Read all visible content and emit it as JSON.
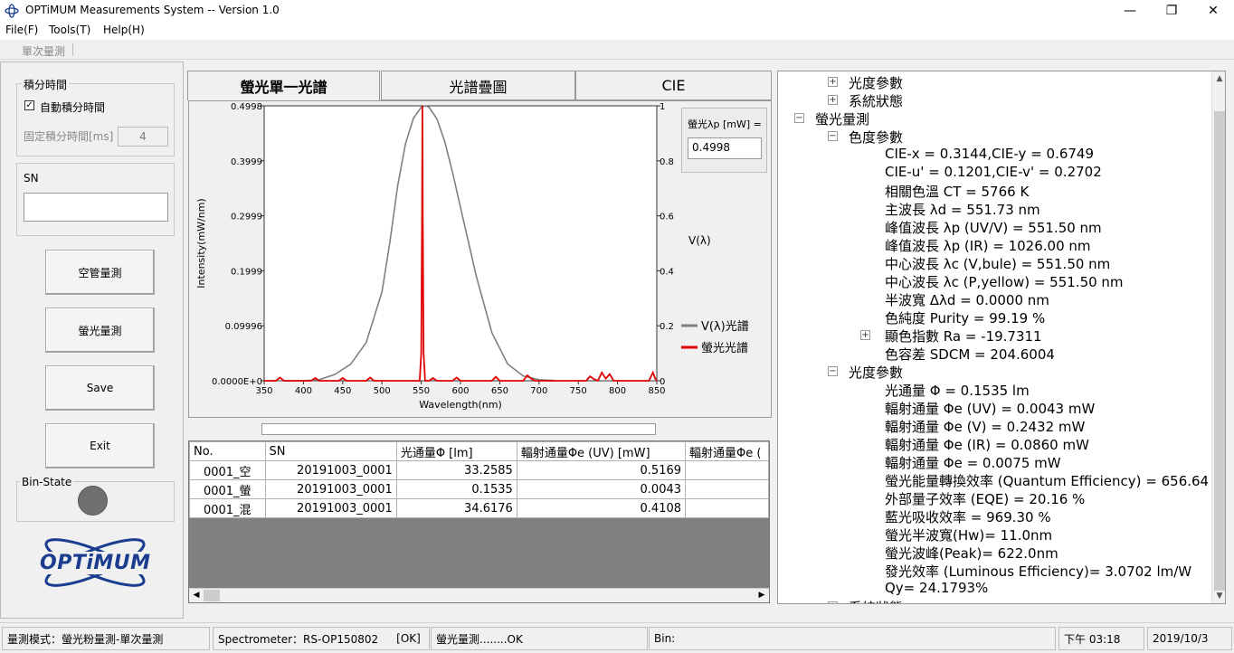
{
  "window": {
    "title": "OPTiMUM Measurements System -- Version 1.0"
  },
  "menu": {
    "file": "File(F)",
    "tools": "Tools(T)",
    "help": "Help(H)"
  },
  "toolbar": {
    "single_measure": "單次量測"
  },
  "left": {
    "integration_group": "積分時間",
    "auto_integration": "自動積分時間",
    "auto_checked": true,
    "fixed_integration_label": "固定積分時間[ms]",
    "fixed_integration_value": "4",
    "sn_label": "SN",
    "sn_value": "",
    "empty_tube_button": "空管量測",
    "fluorescence_button": "螢光量測",
    "save_button": "Save",
    "exit_button": "Exit",
    "bin_state_label": "Bin-State",
    "logo_text": "OPTiMUM"
  },
  "tabs": [
    "螢光單一光譜",
    "光譜疊圖",
    "CIE"
  ],
  "peak_box": {
    "label": "螢光λp [mW] =",
    "value": "0.4998"
  },
  "chart_data": {
    "type": "line",
    "xlabel": "Wavelength(nm)",
    "ylabel": "Intensity(mW/nm)",
    "y2label": "V(λ)",
    "xlim": [
      350,
      850
    ],
    "ylim": [
      0,
      0.4998
    ],
    "y2lim": [
      0,
      1
    ],
    "x_ticks": [
      "350",
      "400",
      "450",
      "500",
      "550",
      "600",
      "650",
      "700",
      "750",
      "800",
      "850"
    ],
    "y_ticks": [
      "0.0000E+0",
      "0.09996",
      "0.1999",
      "0.2999",
      "0.3999",
      "0.4998"
    ],
    "y2_ticks": [
      "0",
      "0.2",
      "0.4",
      "0.6",
      "0.8",
      "1"
    ],
    "legend_position": "right",
    "series": [
      {
        "name": "V(λ)光譜",
        "color": "#808080",
        "axis": "right",
        "x": [
          360,
          380,
          400,
          420,
          440,
          460,
          480,
          500,
          510,
          520,
          530,
          540,
          550,
          555,
          560,
          570,
          580,
          590,
          600,
          620,
          640,
          660,
          680,
          700,
          720
        ],
        "y": [
          0,
          0.0001,
          0.0004,
          0.004,
          0.023,
          0.06,
          0.139,
          0.323,
          0.503,
          0.71,
          0.862,
          0.954,
          0.995,
          1.0,
          0.995,
          0.952,
          0.87,
          0.757,
          0.631,
          0.381,
          0.175,
          0.061,
          0.017,
          0.004,
          0.001
        ]
      },
      {
        "name": "螢光光譜",
        "color": "#e00000",
        "axis": "left",
        "x": [
          350,
          365,
          370,
          375,
          400,
          410,
          415,
          420,
          445,
          450,
          455,
          480,
          485,
          490,
          540,
          548,
          550,
          551,
          551.5,
          552,
          553,
          555,
          560,
          565,
          570,
          590,
          595,
          600,
          640,
          645,
          650,
          680,
          685,
          690,
          695,
          760,
          765,
          770,
          775,
          780,
          785,
          790,
          795,
          840,
          845,
          848,
          850
        ],
        "y": [
          0,
          0,
          0.006,
          0,
          0,
          0,
          0.005,
          0,
          0,
          0.005,
          0,
          0,
          0.006,
          0,
          0,
          0,
          0.05,
          0.3,
          0.4998,
          0.3,
          0.05,
          0,
          0,
          0.005,
          0,
          0,
          0.006,
          0,
          0,
          0.007,
          0,
          0,
          0.01,
          0.004,
          0,
          0,
          0.008,
          0.003,
          0,
          0.015,
          0.004,
          0.012,
          0,
          0,
          0.015,
          0.004,
          0
        ]
      }
    ]
  },
  "table": {
    "headers": [
      "No.",
      "SN",
      "光通量Φ [lm]",
      "輻射通量Φe (UV) [mW]",
      "輻射通量Φe ("
    ],
    "rows": [
      [
        "0001_空",
        "20191003_0001",
        "33.2585",
        "0.5169",
        ""
      ],
      [
        "0001_螢",
        "20191003_0001",
        "0.1535",
        "0.0043",
        ""
      ],
      [
        "0001_混",
        "20191003_0001",
        "34.6176",
        "0.4108",
        ""
      ]
    ]
  },
  "tree": [
    {
      "level": 2,
      "exp": "+",
      "text": "光度參數"
    },
    {
      "level": 2,
      "exp": "+",
      "text": "系統狀態"
    },
    {
      "level": 1,
      "exp": "-",
      "text": "螢光量測"
    },
    {
      "level": 2,
      "exp": "-",
      "text": "色度參數"
    },
    {
      "level": 3,
      "exp": "",
      "text": "CIE-x = 0.3144,CIE-y = 0.6749"
    },
    {
      "level": 3,
      "exp": "",
      "text": "CIE-u' = 0.1201,CIE-v' = 0.2702"
    },
    {
      "level": 3,
      "exp": "",
      "text": "相關色溫 CT = 5766 K"
    },
    {
      "level": 3,
      "exp": "",
      "text": "主波長 λd = 551.73 nm"
    },
    {
      "level": 3,
      "exp": "",
      "text": "峰值波長 λp (UV/V) = 551.50 nm"
    },
    {
      "level": 3,
      "exp": "",
      "text": "峰值波長 λp (IR) = 1026.00 nm"
    },
    {
      "level": 3,
      "exp": "",
      "text": "中心波長 λc (V,bule) = 551.50 nm"
    },
    {
      "level": 3,
      "exp": "",
      "text": "中心波長 λc (P,yellow) = 551.50 nm"
    },
    {
      "level": 3,
      "exp": "",
      "text": "半波寬 Δλd = 0.0000 nm"
    },
    {
      "level": 3,
      "exp": "",
      "text": "色純度 Purity = 99.19 %"
    },
    {
      "level": 3,
      "exp": "+",
      "text": "顯色指數 Ra = -19.7311"
    },
    {
      "level": 3,
      "exp": "",
      "text": "色容差 SDCM = 204.6004"
    },
    {
      "level": 2,
      "exp": "-",
      "text": "光度參數"
    },
    {
      "level": 3,
      "exp": "",
      "text": "光通量 Φ = 0.1535 lm"
    },
    {
      "level": 3,
      "exp": "",
      "text": "輻射通量 Φe (UV) = 0.0043 mW"
    },
    {
      "level": 3,
      "exp": "",
      "text": "輻射通量 Φe (V) = 0.2432 mW"
    },
    {
      "level": 3,
      "exp": "",
      "text": "輻射通量 Φe (IR) = 0.0860 mW"
    },
    {
      "level": 3,
      "exp": "",
      "text": "輻射通量 Φe = 0.0075 mW"
    },
    {
      "level": 3,
      "exp": "",
      "text": "螢光能量轉換效率 (Quantum Efficiency) = 656.64 %"
    },
    {
      "level": 3,
      "exp": "",
      "text": "外部量子效率 (EQE) = 20.16 %"
    },
    {
      "level": 3,
      "exp": "",
      "text": "藍光吸收效率 = 969.30 %"
    },
    {
      "level": 3,
      "exp": "",
      "text": "螢光半波寬(Hw)= 11.0nm"
    },
    {
      "level": 3,
      "exp": "",
      "text": "螢光波峰(Peak)= 622.0nm"
    },
    {
      "level": 3,
      "exp": "",
      "text": "發光效率 (Luminous Efficiency)= 3.0702 lm/W"
    },
    {
      "level": 3,
      "exp": "",
      "text": "Qy= 24.1793%"
    },
    {
      "level": 2,
      "exp": "+",
      "text": "系統狀態"
    }
  ],
  "status": {
    "mode": "量測模式：螢光粉量測-單次量測",
    "spectrometer": "Spectrometer：RS-OP150802",
    "spectrometer_state": "[OK]",
    "measure_state": "螢光量測........OK",
    "bin": "Bin:",
    "time": "下午 03:18",
    "date": "2019/10/3"
  },
  "colors": {
    "accent_red": "#e00000",
    "vlambda_gray": "#808080",
    "logo_blue": "#1a3d8f"
  }
}
